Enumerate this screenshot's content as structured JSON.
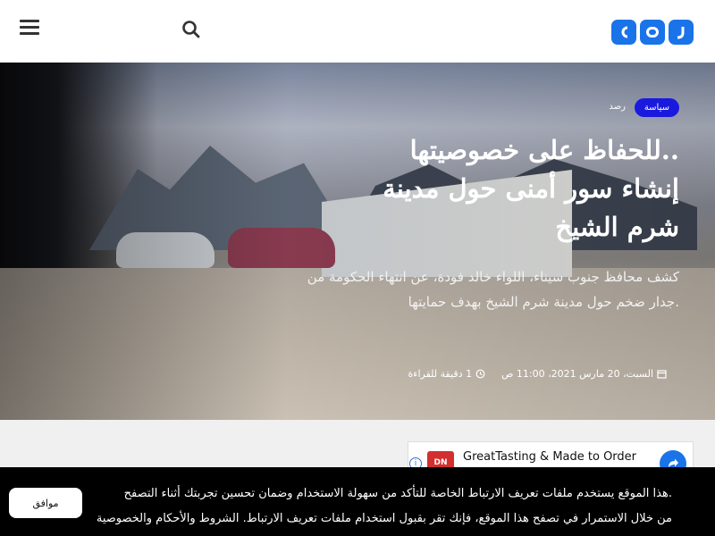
{
  "header": {
    "logo_letters": [
      "ر",
      "ص",
      "د"
    ],
    "menu_icon": "hamburger-menu-icon",
    "search_icon": "search-icon",
    "brand_color": "#1a73e8"
  },
  "article": {
    "category": "سياسة",
    "tag": "رصد",
    "title_line1": "للحفاظ على خصوصيتها..",
    "title_line2": "إنشاء سور أمنى حول مدينة",
    "title_line3": "شرم الشيخ",
    "excerpt": "كشف محافظ جنوب سيناء، اللواء خالد فودة، عن انتهاء الحكومة من جدار ضخم حول مدينة شرم الشيخ بهدف حمايتها.",
    "date": "السبت، 20 مارس 2021، 11:00 ص",
    "read_time": "1 دقيقة للقراءة"
  },
  "ad": {
    "title": "GreatTasting & Made to Order",
    "logo_text": "DN",
    "info_icon": "info-icon",
    "share_icon": "share-icon"
  },
  "cookie_notice": {
    "line1": "هذا الموقع يستخدم ملفات تعريف الارتباط الخاصة للتأكد من سهولة الاستخدام وضمان تحسين تجربتك أثناء التصفح.",
    "line2": "من خلال الاستمرار في تصفح هذا الموقع، فإنك تقر بقبول استخدام ملفات تعريف الارتباط. الشروط والأحكام والخصوصية",
    "accept_label": "موافق"
  }
}
